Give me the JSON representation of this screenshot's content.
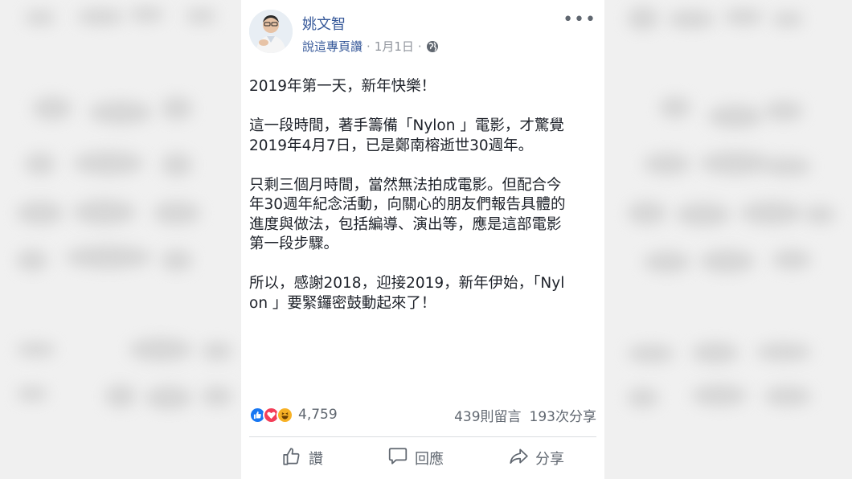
{
  "post": {
    "author": "姚文智",
    "page_like_label": "說這專頁讚",
    "dot1": "·",
    "date": "1月1日",
    "dot2": "·",
    "paragraphs": [
      [
        "2019年第一天，新年快樂！"
      ],
      [
        "這一段時間，著手籌備「Nylon 」電影，才驚覺",
        "2019年4月7日，已是鄭南榕逝世30週年。"
      ],
      [
        "只剩三個月時間，當然無法拍成電影。但配合今",
        "年30週年紀念活動，向關心的朋友們報告具體的",
        "進度與做法，包括編導、演出等，應是這部電影",
        "第一段步驟。"
      ],
      [
        "所以，感謝2018，迎接2019，新年伊始，「Nyl",
        "on 」要緊鑼密鼓動起來了！"
      ]
    ]
  },
  "stats": {
    "reaction_count": "4,759",
    "comments": "439則留言",
    "shares": "193次分享"
  },
  "actions": {
    "like": "讚",
    "comment": "回應",
    "share": "分享"
  },
  "colors": {
    "link": "#365899",
    "like_blue": "#1877f2",
    "love_red": "#f33e58",
    "haha_yellow": "#f7b125"
  }
}
